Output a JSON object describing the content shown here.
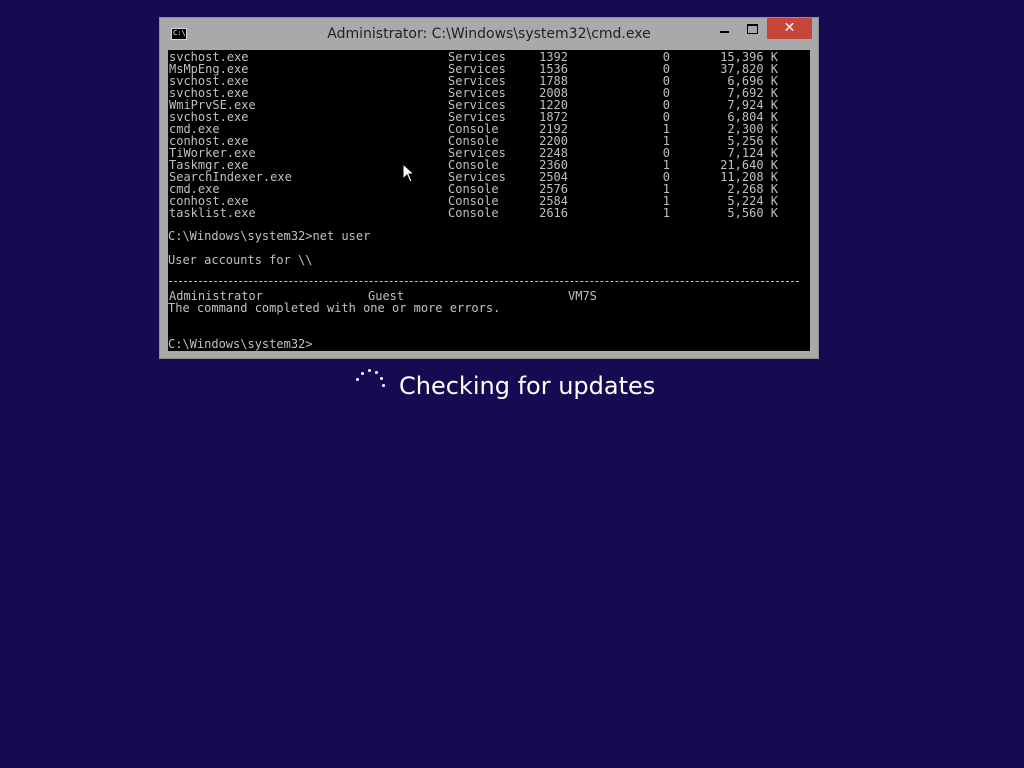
{
  "window": {
    "title": "Administrator: C:\\Windows\\system32\\cmd.exe",
    "icon_label": "C:\\",
    "close_glyph": "✕"
  },
  "console": {
    "processes": [
      {
        "name": "svchost.exe",
        "pid": "1392",
        "session": "Services",
        "num": "0",
        "mem": "15,396 K"
      },
      {
        "name": "MsMpEng.exe",
        "pid": "1536",
        "session": "Services",
        "num": "0",
        "mem": "37,820 K"
      },
      {
        "name": "svchost.exe",
        "pid": "1788",
        "session": "Services",
        "num": "0",
        "mem": "6,696 K"
      },
      {
        "name": "svchost.exe",
        "pid": "2008",
        "session": "Services",
        "num": "0",
        "mem": "7,692 K"
      },
      {
        "name": "WmiPrvSE.exe",
        "pid": "1220",
        "session": "Services",
        "num": "0",
        "mem": "7,924 K"
      },
      {
        "name": "svchost.exe",
        "pid": "1872",
        "session": "Services",
        "num": "0",
        "mem": "6,804 K"
      },
      {
        "name": "cmd.exe",
        "pid": "2192",
        "session": "Console",
        "num": "1",
        "mem": "2,300 K"
      },
      {
        "name": "conhost.exe",
        "pid": "2200",
        "session": "Console",
        "num": "1",
        "mem": "5,256 K"
      },
      {
        "name": "TiWorker.exe",
        "pid": "2248",
        "session": "Services",
        "num": "0",
        "mem": "7,124 K"
      },
      {
        "name": "Taskmgr.exe",
        "pid": "2360",
        "session": "Console",
        "num": "1",
        "mem": "21,640 K"
      },
      {
        "name": "SearchIndexer.exe",
        "pid": "2504",
        "session": "Services",
        "num": "0",
        "mem": "11,208 K"
      },
      {
        "name": "cmd.exe",
        "pid": "2576",
        "session": "Console",
        "num": "1",
        "mem": "2,268 K"
      },
      {
        "name": "conhost.exe",
        "pid": "2584",
        "session": "Console",
        "num": "1",
        "mem": "5,224 K"
      },
      {
        "name": "tasklist.exe",
        "pid": "2616",
        "session": "Console",
        "num": "1",
        "mem": "5,560 K"
      }
    ],
    "command_line": "C:\\Windows\\system32>net user",
    "accounts_header": "User accounts for \\\\",
    "accounts": [
      "Administrator",
      "Guest",
      "VM7S"
    ],
    "completion_message": "The command completed with one or more errors.",
    "prompt": "C:\\Windows\\system32>"
  },
  "status": {
    "text": "Checking for updates"
  }
}
